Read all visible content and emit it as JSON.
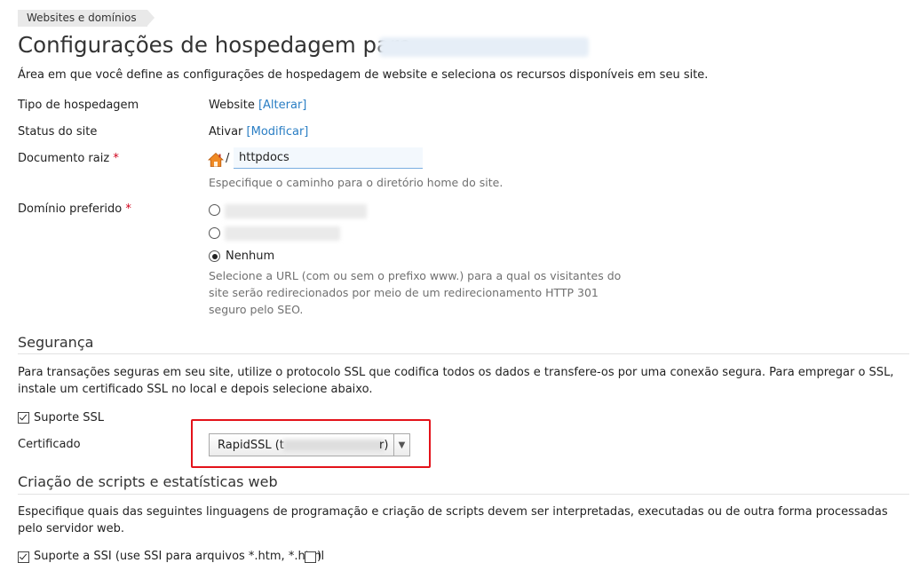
{
  "breadcrumb": "Websites e domínios",
  "title": "Configurações de hospedagem para",
  "intro": "Área em que você define as configurações de hospedagem de website e seleciona os recursos disponíveis em seu site.",
  "hosting_type": {
    "label": "Tipo de hospedagem",
    "value": "Website",
    "action": "[Alterar]"
  },
  "site_status": {
    "label": "Status do site",
    "value": "Ativar",
    "action": "[Modificar]"
  },
  "doc_root": {
    "label": "Documento raiz",
    "required": "*",
    "prefix": "/",
    "value": "httpdocs",
    "hint": "Especifique o caminho para o diretório home do site."
  },
  "preferred_domain": {
    "label": "Domínio preferido",
    "required": "*",
    "option_none": "Nenhum",
    "hint": "Selecione a URL (com ou sem o prefixo www.) para a qual os visitantes do site serão redirecionados por meio de um redirecionamento HTTP 301 seguro pelo SEO."
  },
  "security": {
    "title": "Segurança",
    "description": "Para transações seguras em seu site, utilize o protocolo SSL que codifica todos os dados e transfere-os por uma conexão segura. Para empregar o SSL, instale um certificado SSL no local e depois selecione abaixo.",
    "ssl_label": "Suporte SSL",
    "cert_label": "Certificado",
    "cert_value_start": "RapidSSL (t",
    "cert_value_end": "r)"
  },
  "scripts": {
    "title": "Criação de scripts e estatísticas web",
    "description": "Especifique quais das seguintes linguagens de programação e criação de scripts devem ser interpretadas, executadas ou de outra forma processadas pelo servidor web.",
    "ssi_label": "Suporte a SSI (use SSI para arquivos *.htm, *.html",
    "ssi_label_end": ")"
  },
  "colors": {
    "link": "#2a7ec4",
    "highlight": "#e3121a",
    "required": "#d0021b"
  }
}
